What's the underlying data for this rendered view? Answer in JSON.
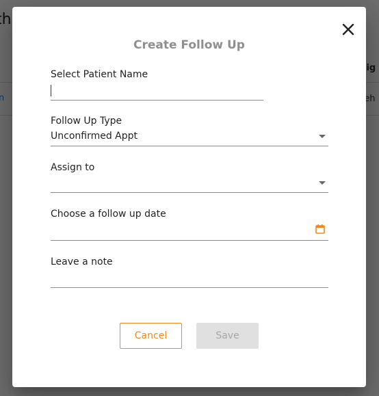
{
  "background": {
    "title_fragment": "th",
    "column_header_fragment": "ssig",
    "cell_left_fragment": "n",
    "cell_right_fragment": "neh"
  },
  "dialog": {
    "title": "Create Follow Up",
    "close_icon": "close-icon",
    "fields": {
      "patient": {
        "label": "Select Patient Name",
        "value": ""
      },
      "follow_up_type": {
        "label": "Follow Up Type",
        "value": "Unconfirmed Appt",
        "icon": "chevron-down-icon"
      },
      "assign_to": {
        "label": "Assign to",
        "value": "",
        "icon": "chevron-down-icon"
      },
      "follow_up_date": {
        "label": "Choose a follow up date",
        "value": "",
        "icon": "calendar-icon"
      },
      "note": {
        "label": "Leave a note",
        "value": ""
      }
    },
    "buttons": {
      "cancel": "Cancel",
      "save": "Save"
    }
  },
  "colors": {
    "accent": "#f08a1c",
    "title": "#8f8f8f",
    "overlay": "rgba(0,0,0,0.57)",
    "disabled_bg": "#e0e0e0",
    "disabled_text": "#a6a6a6"
  }
}
